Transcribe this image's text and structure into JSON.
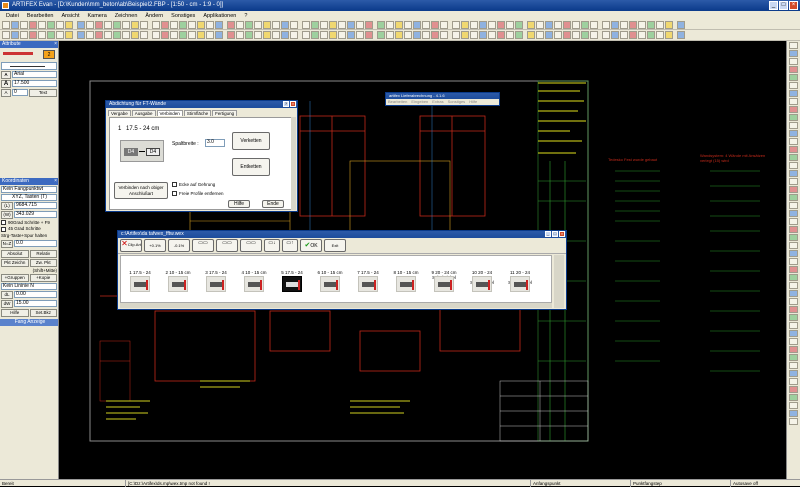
{
  "window": {
    "title": "ARTIFEX Evan - [D:\\Kunden\\mm_beton\\ab\\Beispiel2.FBP - [1:50 - cm - 1:9 - 0]]"
  },
  "menu": [
    "Datei",
    "Bearbeiten",
    "Ansicht",
    "Kamera",
    "Zeichnen",
    "Ändern",
    "Sonstiges",
    "Applikationen",
    "?"
  ],
  "attributes": {
    "title": "Attribute",
    "layer_num": "2",
    "font": "Arial",
    "text_size": "17.500",
    "spacing": "0",
    "text_label": "Text"
  },
  "coordinates": {
    "title": "Koordinaten",
    "mode": "Kein Fangpunktwt",
    "axis_mode": "XYZ, Tasten (T)",
    "x_label": "(L)",
    "x_value": "9684.715",
    "y_label": "(W)",
    "y_value": "343.029",
    "opt1": "90Grad Schritte + F9",
    "opt2": "45 Grad Schritte",
    "opt3": "Strg-Taste+Spur halten",
    "r_label": "N=Z",
    "r_value": "0.0",
    "btn_absolut": "Absolut",
    "btn_relativ": "Relativ",
    "btn_pkt_zeichnen": "Pkt Zeichn",
    "btn_zw_pkt": "Zw. Pkt",
    "mitte_label": "(Shift+Mitte)",
    "btn_gruppen": "+Gruppen",
    "btn_kopie": "+Kopie",
    "lines_mode": "Kein Lininie N",
    "dl_label": "dL",
    "dl_value": "0.00",
    "dw_label": "dW",
    "dw_value": "15.00",
    "btn_hilfe": "Hilfe",
    "btn_set_bkz": "Set.Bkz",
    "footer": "Fang Anzeige"
  },
  "dialog_ft": {
    "title": "Abdichtung für FT-Wände",
    "tabs": [
      "Vergabe",
      "Ausgabe",
      "Verbinden",
      "Stirnfläche",
      "Fertigung"
    ],
    "active_tab": "Verbinden",
    "index": "1",
    "thickness": "17.5 - 24 cm",
    "profile_left": "D4",
    "profile_right": "D4",
    "gap_label": "Spaltbreite :",
    "gap_value": "3.0",
    "btn_verketten": "Verketten",
    "btn_entketten": "Entketten",
    "btn_connect_all": "Verbinden nach obiger Anschlußart",
    "chk_ecke": "Ecke auf Gehrung",
    "chk_freie": "Freie Profile entfernen",
    "btn_hilfe": "Hilfe",
    "btn_ende": "Ende"
  },
  "dialog_small": {
    "title": "artifex Lieferabrechnung - 4.1.6",
    "menu": [
      "Bearbeiten",
      "Eingeben",
      "Extras",
      "Sonstiges",
      "Hilfe"
    ]
  },
  "dialog_wex": {
    "title": "c:\\Artifex\\da tafwex_fftw.wex",
    "toolbar": [
      "Clip.Art",
      "+0.1%",
      "-0.1%",
      "",
      "",
      "",
      "",
      "",
      "OK",
      "Exit"
    ],
    "profiles": [
      {
        "num": "1",
        "label": "17.5 - 24 cm"
      },
      {
        "num": "2",
        "label": "10 - 15 cm"
      },
      {
        "num": "3",
        "label": "17.5 - 24 cm"
      },
      {
        "num": "4",
        "label": "10 - 15 cm"
      },
      {
        "num": "5",
        "label": "17.5 - 24 cm"
      },
      {
        "num": "6",
        "label": "10 - 15 cm"
      },
      {
        "num": "7",
        "label": "17.5 - 24 cm"
      },
      {
        "num": "8",
        "label": "10 - 15 cm"
      },
      {
        "num": "9",
        "label": "20 - 24 cm Schalwinkel - 15"
      },
      {
        "num": "10",
        "label": "20 - 24 cm Schalwinkel - 15"
      },
      {
        "num": "11",
        "label": "20 - 24 cm Schalwinkel - 15"
      }
    ],
    "selected_index": 4
  },
  "drawing_labels": {
    "left_green": "Tedesko Fest wurde gebaut",
    "right_green": "Wandsystem: 4 Wände mit Ansätzen verlegt (15) wird"
  },
  "status": {
    "left": "Bereit",
    "path": "[C:\\Dz:\\Artifex\\ds.mp\\wex.tmp not found !",
    "p1": "Anfangspunkt",
    "p2": "Punktfangstep",
    "p3": "Autosave off"
  }
}
